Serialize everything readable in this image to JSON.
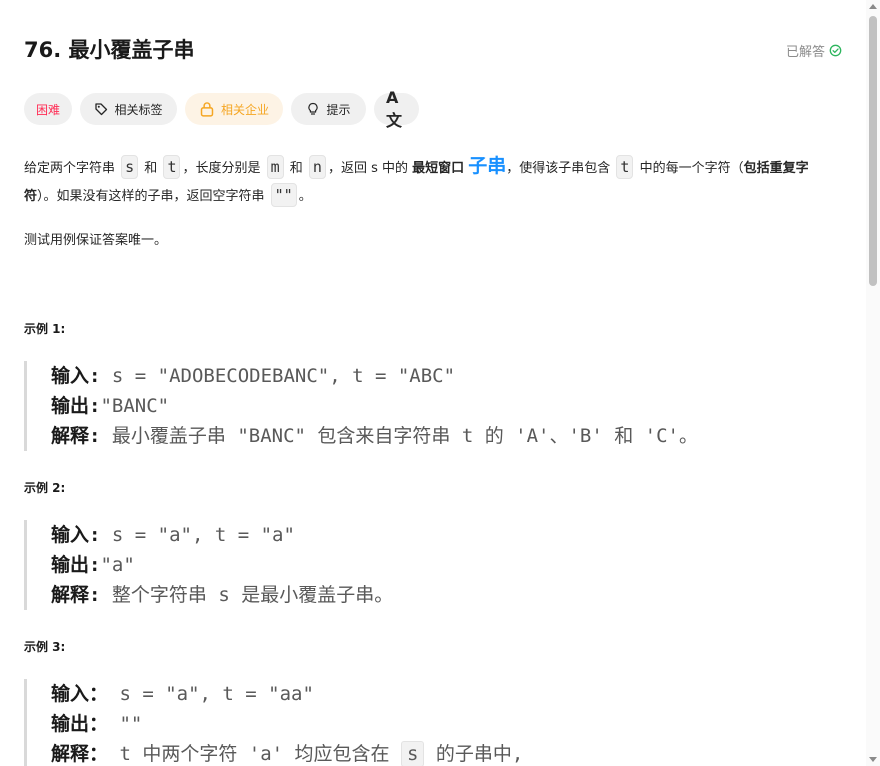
{
  "problem": {
    "title": "76. 最小覆盖子串",
    "solved_label": "已解答",
    "colors": {
      "hard": "#ff2d55",
      "company": "#f5a623",
      "link": "#1890ff",
      "solved": "#2db55d"
    }
  },
  "tags": {
    "difficulty": "困难",
    "related_tags": "相关标签",
    "related_company": "相关企业",
    "hint": "提示",
    "translate": "A文"
  },
  "description": {
    "p1_a": "给定两个字符串 ",
    "code_s": "s",
    "p1_b": " 和 ",
    "code_t": "t",
    "p1_c": "，长度分别是 ",
    "code_m": "m",
    "p1_d": " 和 ",
    "code_n": "n",
    "p1_e": "，返回 s 中的 ",
    "shortest_window": "最短窗口",
    "substring": "子串",
    "p1_f": "，使得该子串包含 ",
    "code_t2": "t",
    "p1_g": " 中的每一个字符（",
    "include_dup": "包括重复字符",
    "p1_h": "）。如果没有这样的子串，返回空字符串 ",
    "code_empty": "\"\"",
    "p1_i": "。",
    "note": "测试用例保证答案唯一。"
  },
  "examples": [
    {
      "label": "示例 1:",
      "input_key": "输入:",
      "input_val": " s = \"ADOBECODEBANC\", t = \"ABC\"",
      "output_key": "输出:",
      "output_val": "\"BANC\"",
      "explain_key": "解释:",
      "explain_val": " 最小覆盖子串 \"BANC\" 包含来自字符串 t 的 'A'、'B' 和 'C'。"
    },
    {
      "label": "示例 2:",
      "input_key": "输入:",
      "input_val": " s = \"a\", t = \"a\"",
      "output_key": "输出:",
      "output_val": "\"a\"",
      "explain_key": "解释:",
      "explain_val": " 整个字符串 s 是最小覆盖子串。"
    },
    {
      "label": "示例 3:",
      "input_key": "输入：",
      "input_val": " s = \"a\", t = \"aa\"",
      "output_key": "输出：",
      "output_val": " \"\"",
      "explain_key": "解释：",
      "explain_a": " t 中两个字符 'a' 均应包含在 ",
      "explain_s": "s",
      "explain_b": " 的子串中,"
    }
  ]
}
